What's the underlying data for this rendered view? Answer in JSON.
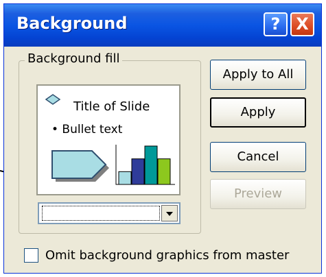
{
  "dialog": {
    "title": "Background",
    "help_label": "?",
    "close_label": "X"
  },
  "fill_group": {
    "label": "Background fill",
    "preview": {
      "slide_title": "Title of Slide",
      "bullet_text": "• Bullet text",
      "chart_bars": [
        {
          "value": 1,
          "color": "#a9dde4"
        },
        {
          "value": 2,
          "color": "#2f3c9a"
        },
        {
          "value": 3,
          "color": "#009999"
        },
        {
          "value": 2,
          "color": "#8dc81e"
        }
      ]
    },
    "color_dropdown": {
      "value": ""
    }
  },
  "buttons": {
    "apply_all": "Apply to All",
    "apply": "Apply",
    "cancel": "Cancel",
    "preview": "Preview"
  },
  "omit_checkbox": {
    "label": "Omit background graphics from master",
    "checked": false
  },
  "colors": {
    "title_bar": "#0a55e3",
    "dialog_face": "#ece9d8",
    "close_button": "#dc4b24"
  }
}
